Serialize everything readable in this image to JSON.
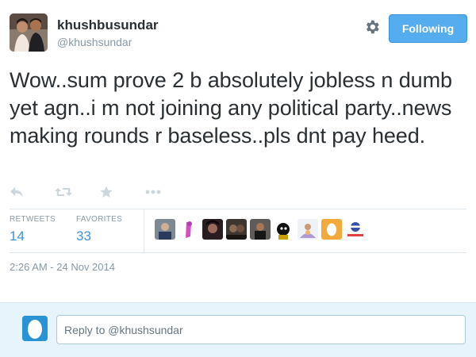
{
  "user": {
    "full_name": "khushbusundar",
    "screen_name": "@khushsundar",
    "avatar_icon": "profile-photo"
  },
  "follow_button": {
    "label": "Following",
    "color": "#55acee"
  },
  "tweet": {
    "text": "Wow..sum prove 2 b absolutely jobless n dumb yet agn..i m not joining any political party..news making rounds r baseless..pls dnt pay heed."
  },
  "actions": [
    "reply-icon",
    "retweet-icon",
    "favorite-icon",
    "more-icon"
  ],
  "stats": {
    "retweets_label": "RETWEETS",
    "retweets_count": "14",
    "favorites_label": "FAVORITES",
    "favorites_count": "33"
  },
  "favoriter_avatar_count": 10,
  "timestamp": "2:26 AM - 24 Nov 2014",
  "reply": {
    "placeholder": "Reply to @khushsundar"
  },
  "colors": {
    "link": "#3b94d9",
    "muted": "#8899a6",
    "reply_bg": "#e8f4fc"
  }
}
